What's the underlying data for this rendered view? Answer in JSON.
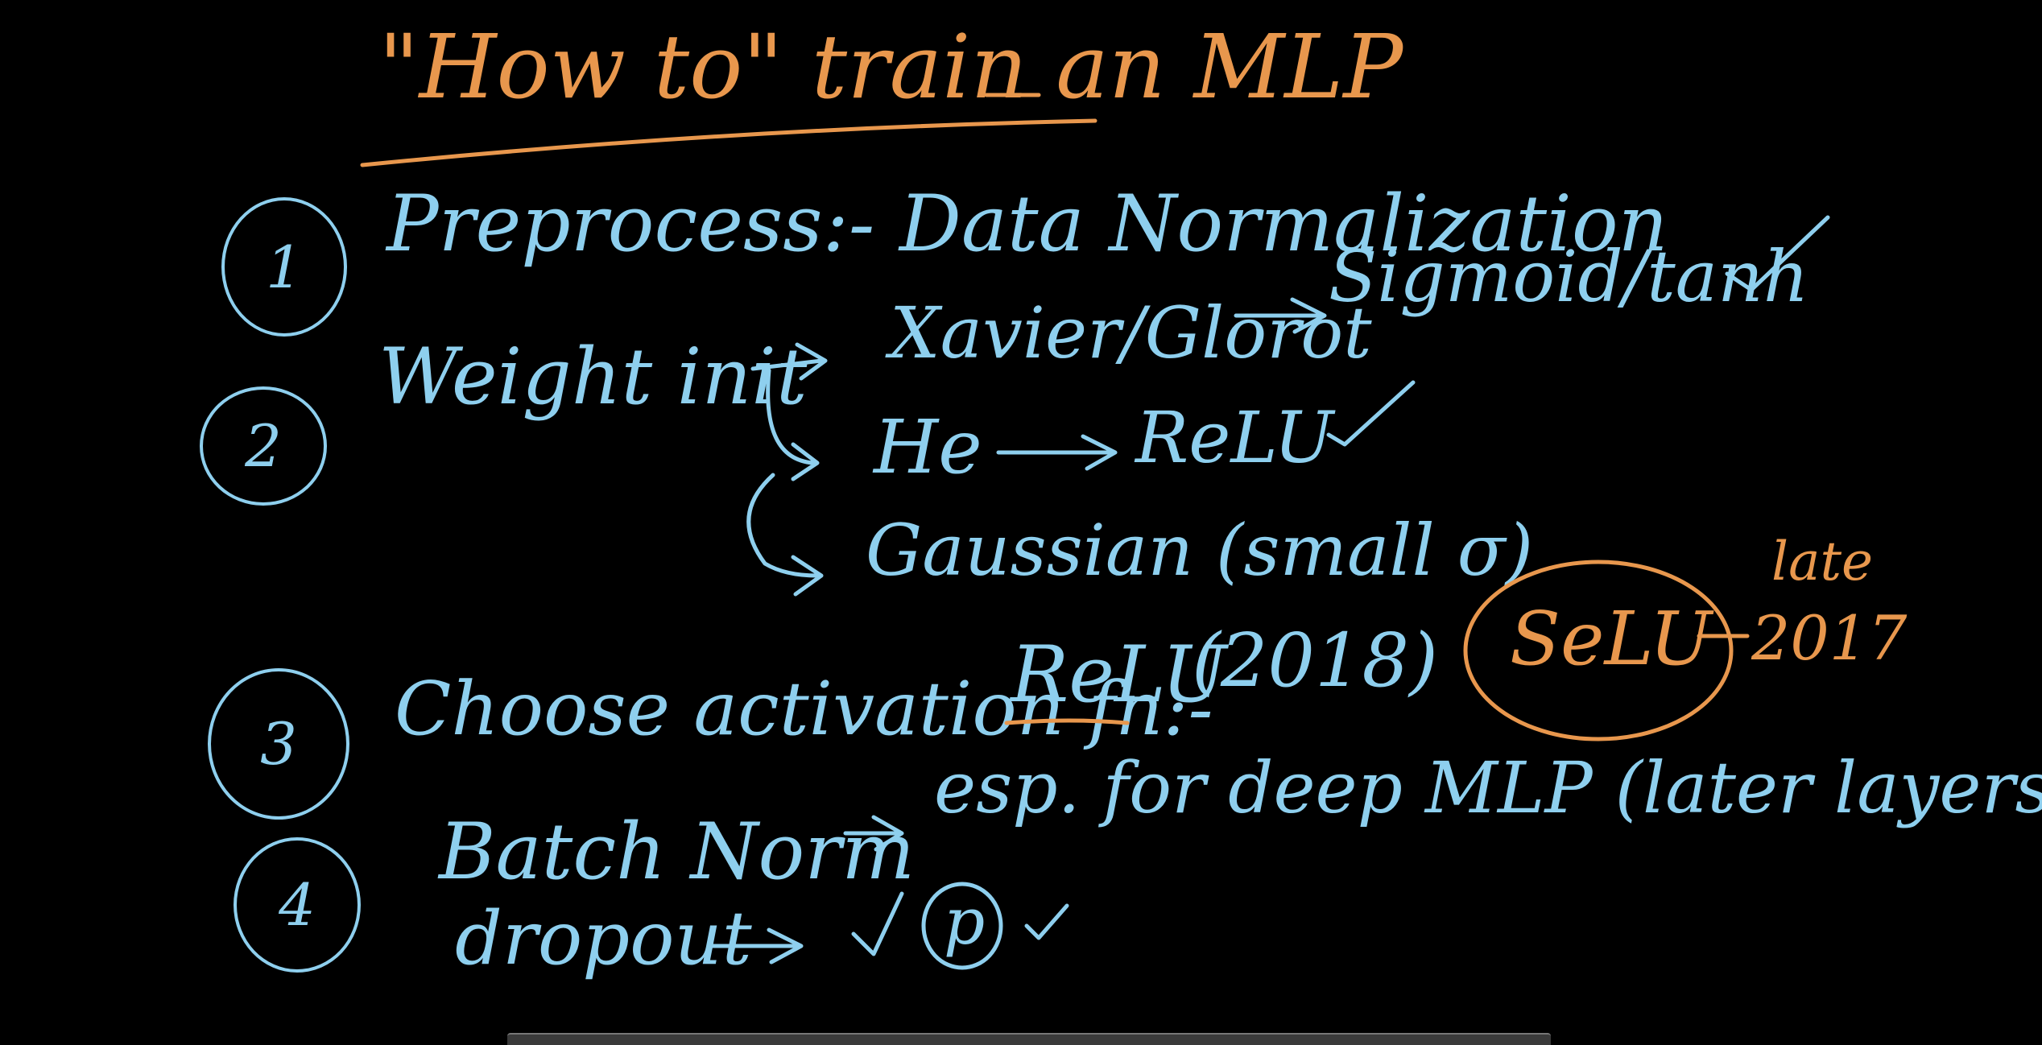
{
  "colors": {
    "background": "#000000",
    "ink_blue": "#8ecfee",
    "ink_orange": "#e8974d"
  },
  "title": {
    "text": "\"How to\" train an MLP"
  },
  "steps": [
    {
      "number": "1",
      "text": "Preprocess:- Data Normalization"
    },
    {
      "number": "2",
      "text": "Weight init"
    },
    {
      "number": "3",
      "text": "Choose activation fn:-"
    },
    {
      "number": "4",
      "text": "Batch Norm"
    }
  ],
  "weight_init": {
    "xavier": "Xavier/Glorot",
    "xavier_target": "Sigmoid/tanh",
    "he": "He",
    "he_target": "ReLU",
    "gaussian": "Gaussian (small σ)"
  },
  "activation": {
    "relu": "ReLU",
    "relu_year": "(2018)",
    "selu": "SeLU",
    "selu_year": "2017",
    "selu_note": "late"
  },
  "batch_norm": {
    "note": "esp. for deep MLP (later layers)"
  },
  "dropout": {
    "label": "dropout",
    "param": "p"
  },
  "icons": [
    "arrow-right-icon",
    "checkmark-icon"
  ]
}
